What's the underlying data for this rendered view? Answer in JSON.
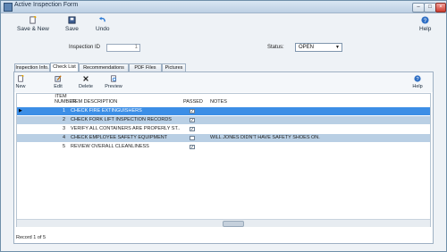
{
  "window": {
    "title": "Active Inspection Form"
  },
  "toolbar": {
    "save_new": "Save & New",
    "save": "Save",
    "undo": "Undo",
    "help": "Help"
  },
  "header": {
    "inspection_id_label": "Inspection ID",
    "inspection_id_value": "1",
    "status_label": "Status:",
    "status_value": "OPEN"
  },
  "tabs": [
    "Inspection Info.",
    "Check List",
    "Recommendations",
    "PDF Files",
    "Pictures"
  ],
  "subtoolbar": {
    "new": "New",
    "edit": "Edit",
    "delete": "Delete",
    "preview": "Preview",
    "help": "Help"
  },
  "grid": {
    "columns": {
      "item_number": "ITEM NUMBER",
      "item_description": "ITEM DESCRIPTION",
      "passed": "PASSED",
      "notes": "NOTES"
    },
    "rows": [
      {
        "num": "1",
        "desc": "CHECK FIRE EXTINGUISHERS",
        "passed": true,
        "notes": ""
      },
      {
        "num": "2",
        "desc": "CHECK FORK LIFT INSPECTION RECORDS",
        "passed": true,
        "notes": ""
      },
      {
        "num": "3",
        "desc": "VERIFY ALL CONTAINERS ARE PROPERLY ST...",
        "passed": true,
        "notes": ""
      },
      {
        "num": "4",
        "desc": "CHECK EMPLOYEE SAFETY EQUIPMENT",
        "passed": false,
        "notes": "WILL JONES DIDN'T HAVE SAFETY SHOES ON."
      },
      {
        "num": "5",
        "desc": "REVIEW OVERALL CLEANLINESS",
        "passed": true,
        "notes": ""
      }
    ]
  },
  "status_bar": {
    "record_text": "Record 1 of 5"
  },
  "colors": {
    "selected_row": "#3c8ee6",
    "alt_row": "#b9cfe4",
    "window_bg": "#eef2f6"
  }
}
